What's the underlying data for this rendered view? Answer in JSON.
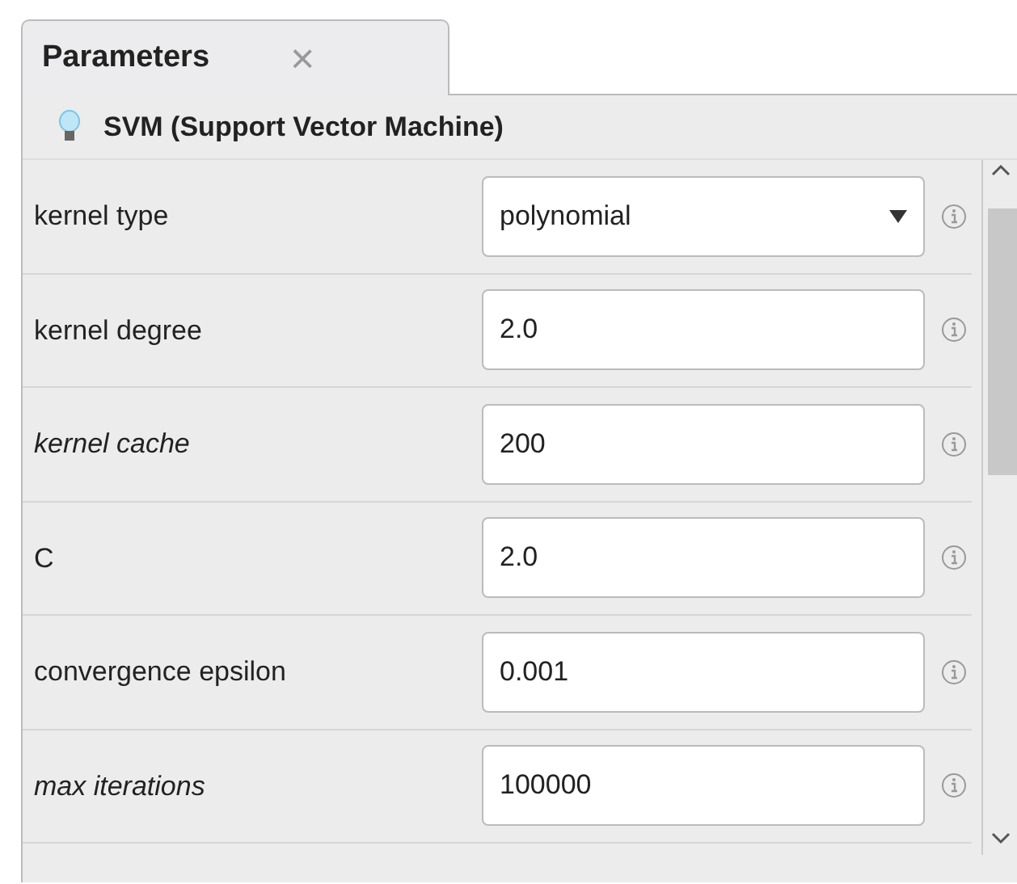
{
  "tabs": [
    {
      "label": "Parameters",
      "selected": true,
      "close": "×"
    }
  ],
  "operator": {
    "title": "SVM (Support Vector Machine)"
  },
  "parameters": [
    {
      "label": "kernel type",
      "italic": false,
      "kind": "select",
      "value": "polynomial"
    },
    {
      "label": "kernel degree",
      "italic": false,
      "kind": "text",
      "value": "2.0"
    },
    {
      "label": "kernel cache",
      "italic": true,
      "kind": "text",
      "value": "200"
    },
    {
      "label": "C",
      "italic": false,
      "kind": "text",
      "value": "2.0"
    },
    {
      "label": "convergence epsilon",
      "italic": false,
      "kind": "text",
      "value": "0.001"
    },
    {
      "label": "max iterations",
      "italic": true,
      "kind": "text",
      "value": "100000"
    }
  ]
}
